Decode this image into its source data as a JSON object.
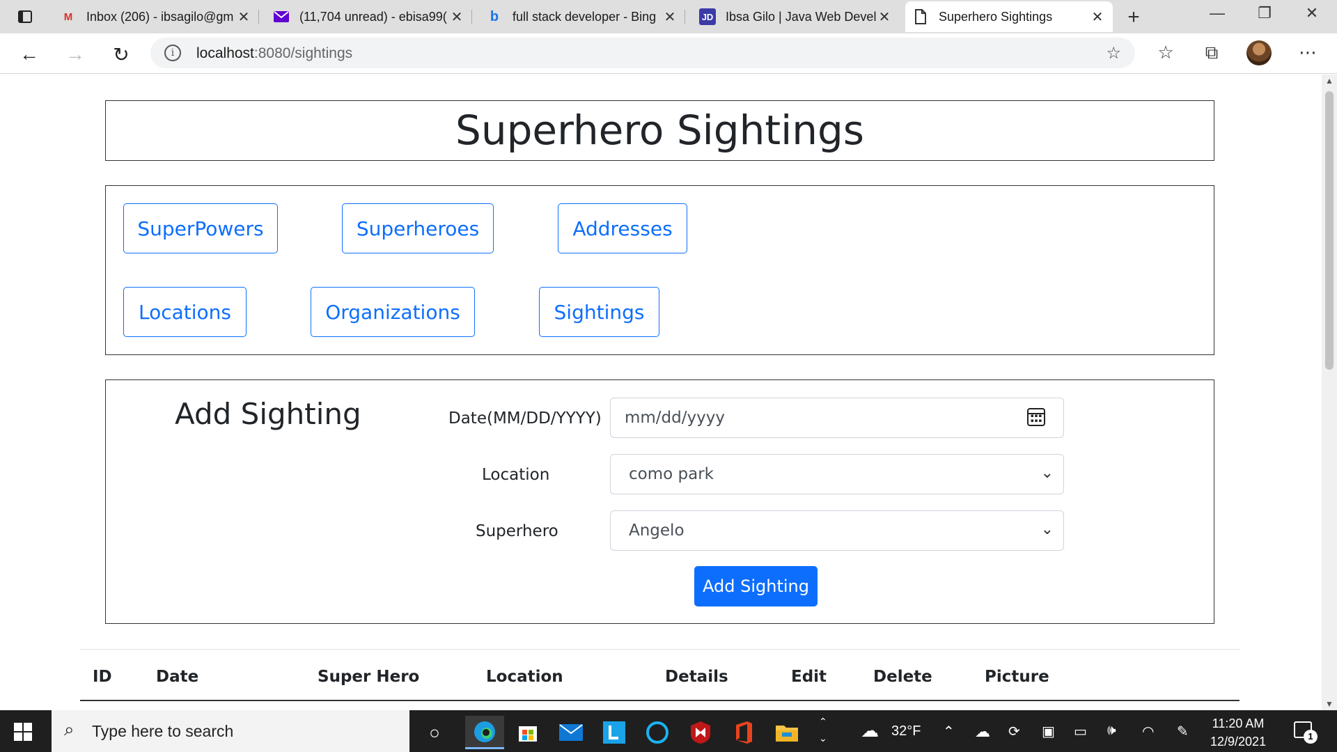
{
  "browser": {
    "tabs": [
      {
        "title": "Inbox (206) - ibsagilo@gm",
        "favicon": "gmail-icon",
        "favicon_color": "#d93025"
      },
      {
        "title": "(11,704 unread) - ebisa99(",
        "favicon": "yahoo-mail-icon",
        "favicon_color": "#6001d2"
      },
      {
        "title": "full stack developer - Bing",
        "favicon": "bing-icon",
        "favicon_color": "#1a73e8"
      },
      {
        "title": "Ibsa Gilo | Java Web Devel",
        "favicon": "jd-icon",
        "favicon_label": "JD",
        "favicon_color": "#3b3ba8"
      },
      {
        "title": "Superhero Sightings",
        "favicon": "page-icon"
      }
    ],
    "address": {
      "host": "localhost",
      "path": ":8080/sightings"
    }
  },
  "page": {
    "title": "Superhero Sightings",
    "nav": [
      "SuperPowers",
      "Superheroes",
      "Addresses",
      "Locations",
      "Organizations",
      "Sightings"
    ],
    "form": {
      "title": "Add Sighting",
      "date_label": "Date(MM/DD/YYYY)",
      "date_placeholder": "mm/dd/yyyy",
      "location_label": "Location",
      "location_value": "como park",
      "superhero_label": "Superhero",
      "superhero_value": "Angelo",
      "submit_label": "Add Sighting"
    },
    "table": {
      "headers": [
        "ID",
        "Date",
        "Super Hero",
        "Location",
        "Details",
        "Edit",
        "Delete",
        "Picture"
      ]
    },
    "accent_color": "#0d6efd"
  },
  "taskbar": {
    "search_placeholder": "Type here to search",
    "weather": "32°F",
    "time": "11:20 AM",
    "date": "12/9/2021",
    "notification_count": "1"
  }
}
